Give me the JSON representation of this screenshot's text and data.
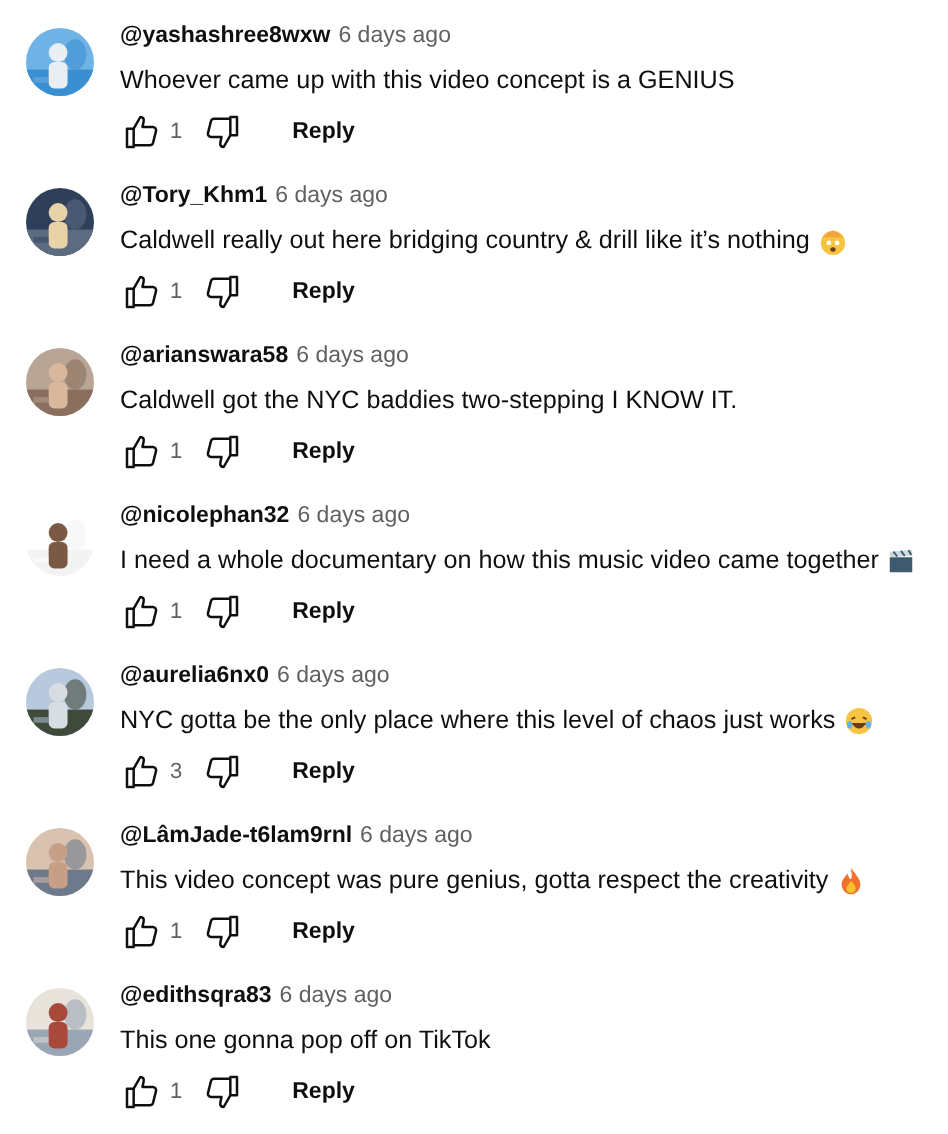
{
  "comments": [
    {
      "author": "@yashashree8wxw",
      "time": "6 days ago",
      "text": "Whoever came up with this video concept is a GENIUS",
      "likes": "1",
      "reply": "Reply"
    },
    {
      "author": "@Tory_Khm1",
      "time": "6 days ago",
      "text": "Caldwell really out here bridging country & drill like it’s nothing",
      "emoji": {
        "kind": "exploding-head"
      },
      "likes": "1",
      "reply": "Reply"
    },
    {
      "author": "@arianswara58",
      "time": "6 days ago",
      "text": "Caldwell got the NYC baddies two-stepping I KNOW IT.",
      "likes": "1",
      "reply": "Reply"
    },
    {
      "author": "@nicolephan32",
      "time": "6 days ago",
      "text": "I need a whole documentary on how this music video came together",
      "emoji": {
        "kind": "clapper"
      },
      "likes": "1",
      "reply": "Reply"
    },
    {
      "author": "@aurelia6nx0",
      "time": "6 days ago",
      "text": "NYC gotta be the only place where this level of chaos just works",
      "emoji": {
        "kind": "laughing"
      },
      "likes": "3",
      "reply": "Reply"
    },
    {
      "author": "@LâmJade-t6lam9rnl",
      "time": "6 days ago",
      "text": "This video concept was pure genius, gotta respect the creativity",
      "emoji": {
        "kind": "fire"
      },
      "likes": "1",
      "reply": "Reply"
    },
    {
      "author": "@edithsqra83",
      "time": "6 days ago",
      "text": "This one gonna pop off on TikTok",
      "likes": "1",
      "reply": "Reply"
    }
  ]
}
